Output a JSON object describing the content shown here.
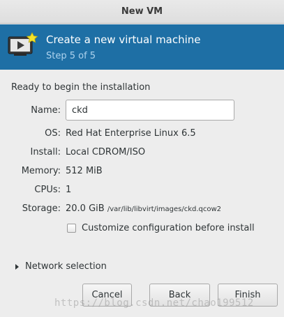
{
  "window": {
    "title": "New VM"
  },
  "banner": {
    "icon": "vm-monitor-icon",
    "title": "Create a new virtual machine",
    "step": "Step 5 of 5",
    "background_color": "#1e6fa5"
  },
  "summary": {
    "heading": "Ready to begin the installation",
    "name_label": "Name:",
    "name_value": "ckd",
    "os_label": "OS:",
    "os_value": "Red Hat Enterprise Linux 6.5",
    "install_label": "Install:",
    "install_value": "Local CDROM/ISO",
    "memory_label": "Memory:",
    "memory_value": "512 MiB",
    "cpus_label": "CPUs:",
    "cpus_value": "1",
    "storage_label": "Storage:",
    "storage_size": "20.0 GiB",
    "storage_path": "/var/lib/libvirt/images/ckd.qcow2"
  },
  "options": {
    "customize_label": "Customize configuration before install",
    "customize_checked": false,
    "network_label": "Network selection",
    "network_expanded": false
  },
  "buttons": {
    "cancel": "Cancel",
    "back": "Back",
    "finish": "Finish"
  },
  "watermark": "https://blog.csdn.net/chao199512"
}
